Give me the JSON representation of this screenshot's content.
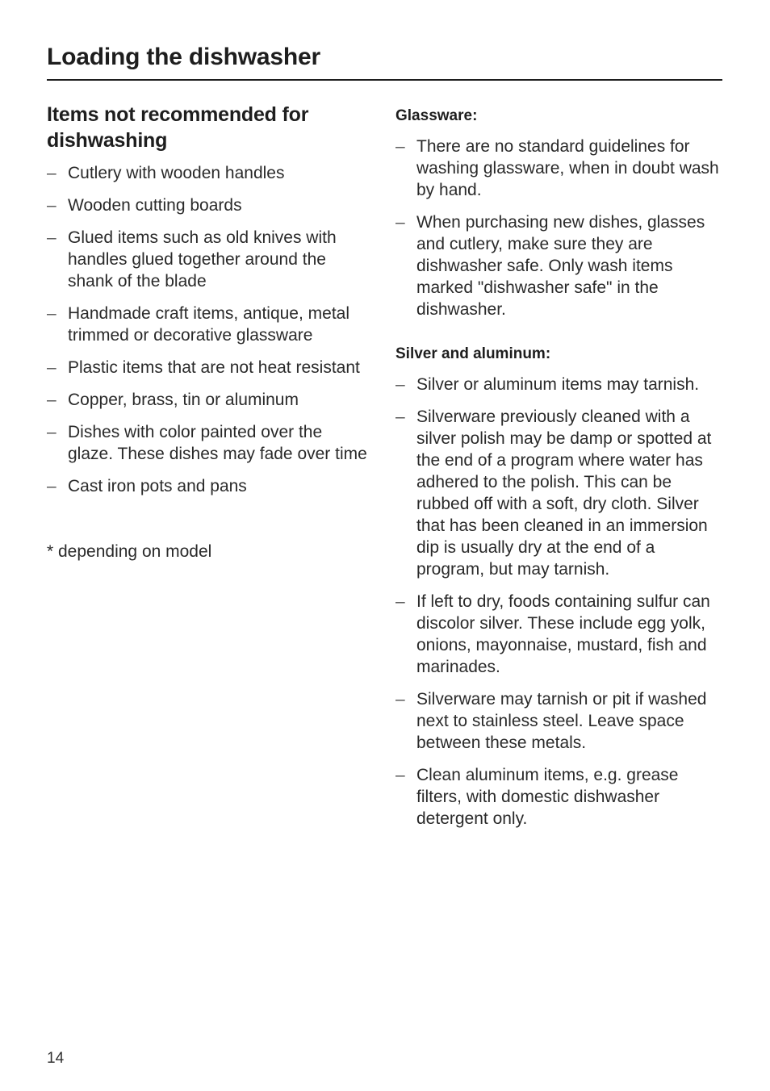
{
  "header": {
    "title": "Loading the dishwasher"
  },
  "left_column": {
    "heading": "Items not recommended for dishwashing",
    "bullet_glyph": "–",
    "items": [
      "Cutlery with wooden handles",
      "Wooden cutting boards",
      "Glued items such as old knives with handles glued together around the shank of the blade",
      "Handmade craft items, antique, metal trimmed or decorative glassware",
      "Plastic items that are not heat resistant",
      "Copper, brass, tin or aluminum",
      "Dishes with color painted over the glaze. These dishes may fade over time",
      "Cast iron pots and pans"
    ],
    "footnote": "* depending on model"
  },
  "right_column": {
    "bullet_glyph": "–",
    "sections": [
      {
        "heading": "Glassware:",
        "items": [
          "There are no standard guidelines for washing glassware, when in doubt wash by hand.",
          "When purchasing new dishes, glasses and cutlery, make sure they are dishwasher safe. Only wash items marked \"dishwasher safe\" in the dishwasher."
        ]
      },
      {
        "heading": "Silver and aluminum:",
        "items": [
          "Silver or aluminum items may tarnish.",
          "Silverware previously cleaned with a silver polish may be damp or spotted at the end of a program where water has adhered to the polish. This can be rubbed off with a soft, dry cloth. Silver that has been cleaned in an immersion dip is usually dry at the end of a program, but may tarnish.",
          "If left to dry, foods containing sulfur can discolor silver. These include egg yolk, onions, mayonnaise, mustard, fish and marinades.",
          "Silverware may tarnish or pit if washed next to stainless steel. Leave space between these metals.",
          "Clean aluminum items, e.g. grease filters, with domestic dishwasher detergent only."
        ]
      }
    ]
  },
  "footer": {
    "page_number": "14"
  }
}
